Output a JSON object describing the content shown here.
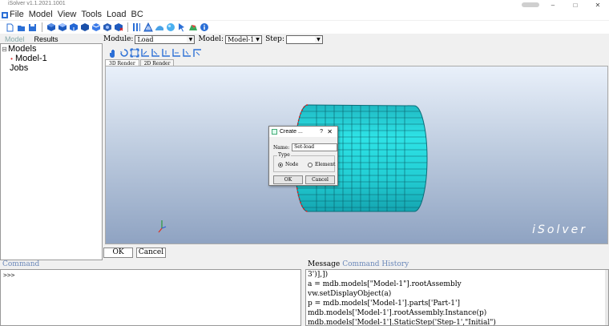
{
  "window": {
    "title": "iSolver v1.1.2021.1001"
  },
  "menu": [
    "File",
    "Model",
    "View",
    "Tools",
    "Load",
    "BC"
  ],
  "left_panel": {
    "tabs": [
      "Model",
      "Results"
    ],
    "tree": {
      "models": "Models",
      "model1": "Model-1",
      "jobs": "Jobs"
    }
  },
  "module_bar": {
    "module_label": "Module:",
    "module_value": "Load",
    "model_label": "Model:",
    "model_value": "Model-1",
    "step_label": "Step:",
    "step_value": ""
  },
  "render_tabs": [
    "3D Render",
    "2D Render"
  ],
  "viewport": {
    "brand": "iSolver"
  },
  "dialog": {
    "title": "Create ...",
    "help": "?",
    "close": "✕",
    "name_label": "Name:",
    "name_value": "Set-load",
    "group_label": "Type",
    "radio_node": "Node",
    "radio_element": "Element",
    "selected": "Node",
    "ok": "OK",
    "cancel": "Cancel"
  },
  "bottom_buttons": {
    "ok": "OK",
    "cancel": "Cancel"
  },
  "command": {
    "tab": "Command",
    "prompt": ">>>"
  },
  "messages": {
    "tabs": [
      "Message",
      "Command History"
    ],
    "lines": [
      "3')],])",
      "a = mdb.models[\"Model-1\"].rootAssembly",
      "vw.setDisplayObject(a)",
      "p = mdb.models['Model-1'].parts['Part-1']",
      "mdb.models['Model-1'].rootAssembly.Instance(p)",
      "mdb.models['Model-1'].StaticStep('Step-1',\"Initial\")"
    ]
  },
  "colors": {
    "cylinder": "#26d4d8",
    "selection": "#e02020",
    "viewport_top": "#e9f0fa",
    "viewport_bottom": "#8fa3c2"
  }
}
